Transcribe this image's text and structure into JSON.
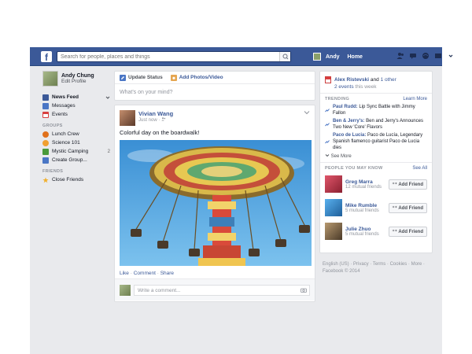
{
  "topbar": {
    "logo": "f",
    "search_placeholder": "Search for people, places and things",
    "user": "Andy",
    "home": "Home"
  },
  "left": {
    "profile_name": "Andy Chung",
    "edit_profile": "Edit Profile",
    "nav": [
      {
        "label": "News Feed",
        "icon": "news-feed-icon",
        "color": "#3b5998"
      },
      {
        "label": "Messages",
        "icon": "messages-icon",
        "color": "#4a76c5"
      },
      {
        "label": "Events",
        "icon": "events-icon",
        "color": "#d83f3f"
      }
    ],
    "groups_header": "GROUPS",
    "groups": [
      {
        "label": "Lunch Crew",
        "icon": "lunch-crew-icon",
        "color": "#e0711c",
        "count": ""
      },
      {
        "label": "Science 101",
        "icon": "science-icon",
        "color": "#f0a030",
        "count": ""
      },
      {
        "label": "Mystic Camping",
        "icon": "camping-icon",
        "color": "#4a9a3a",
        "count": "2"
      },
      {
        "label": "Create Group...",
        "icon": "create-group-icon",
        "color": "#4a76c5",
        "count": ""
      }
    ],
    "friends_header": "FRIENDS",
    "friends": [
      {
        "label": "Close Friends",
        "icon": "star-icon",
        "color": "#f0b030"
      }
    ]
  },
  "composer": {
    "update_status": "Update Status",
    "add_photos": "Add Photos/Video",
    "placeholder": "What's on your mind?"
  },
  "post": {
    "author": "Vivian Wang",
    "meta": "Just now · ",
    "text": "Colorful day on the boardwalk!",
    "like": "Like",
    "comment": "Comment",
    "share": "Share",
    "sep": " · ",
    "comment_placeholder": "Write a comment..."
  },
  "right": {
    "event_name": "Alex Ristevski",
    "event_and": " and ",
    "event_other": "1 other",
    "event_count": "2 events",
    "event_when": " this week",
    "trending_header": "TRENDING",
    "learn_more": "Learn More",
    "trends": [
      {
        "name": "Paul Rudd:",
        "desc": " Lip Sync Battle with Jimmy Fallon"
      },
      {
        "name": "Ben & Jerry's:",
        "desc": " Ben and Jerry's Announces Two New 'Core' Flavors"
      },
      {
        "name": "Paco de Lucia:",
        "desc": " Paco de Lucía, Legendary Spanish flamenco guitarist Paco de Lucia dies"
      }
    ],
    "see_more": "See More",
    "pymk_header": "PEOPLE YOU MAY KNOW",
    "see_all": "See All",
    "people": [
      {
        "name": "Greg Marra",
        "mutual": "12 mutual friends",
        "btn": "Add Friend",
        "color": "#c2404f"
      },
      {
        "name": "Mike Rumble",
        "mutual": "5 mutual friends",
        "btn": "Add Friend",
        "color": "#3a8fd8"
      },
      {
        "name": "Julie Zhuo",
        "mutual": "5 mutual friends",
        "btn": "Add Friend",
        "color": "#8a7250"
      }
    ]
  },
  "footer": {
    "line1": "English (US) · Privacy · Terms · Cookies · More ·",
    "line2": "Facebook © 2014"
  }
}
